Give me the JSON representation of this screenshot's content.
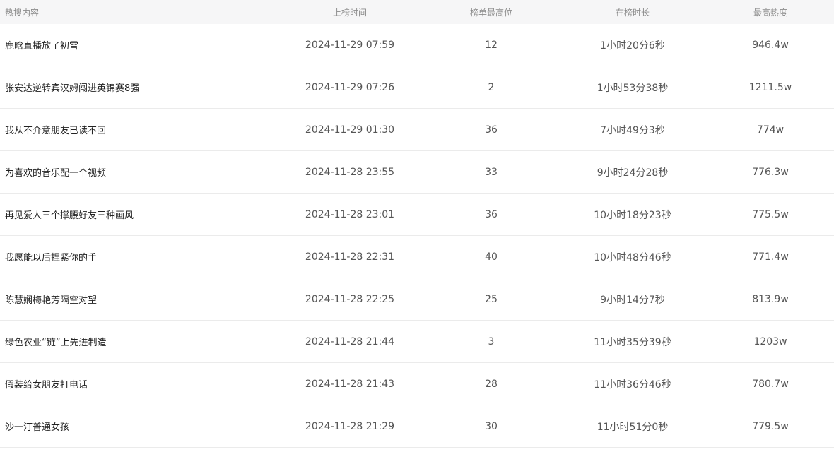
{
  "header": {
    "title": "热搜内容",
    "time": "上榜时间",
    "rank": "榜单最高位",
    "duration": "在榜时长",
    "heat": "最高热度"
  },
  "rows": [
    {
      "title": "鹿晗直播放了初雪",
      "time": "2024-11-29 07:59",
      "rank": "12",
      "duration": "1小时20分6秒",
      "heat": "946.4w"
    },
    {
      "title": "张安达逆转宾汉姆闯进英锦赛8强",
      "time": "2024-11-29 07:26",
      "rank": "2",
      "duration": "1小时53分38秒",
      "heat": "1211.5w"
    },
    {
      "title": "我从不介意朋友已读不回",
      "time": "2024-11-29 01:30",
      "rank": "36",
      "duration": "7小时49分3秒",
      "heat": "774w"
    },
    {
      "title": "为喜欢的音乐配一个视频",
      "time": "2024-11-28 23:55",
      "rank": "33",
      "duration": "9小时24分28秒",
      "heat": "776.3w"
    },
    {
      "title": "再见爱人三个撑腰好友三种画风",
      "time": "2024-11-28 23:01",
      "rank": "36",
      "duration": "10小时18分23秒",
      "heat": "775.5w"
    },
    {
      "title": "我愿能以后捏紧你的手",
      "time": "2024-11-28 22:31",
      "rank": "40",
      "duration": "10小时48分46秒",
      "heat": "771.4w"
    },
    {
      "title": "陈慧娴梅艳芳隔空对望",
      "time": "2024-11-28 22:25",
      "rank": "25",
      "duration": "9小时14分7秒",
      "heat": "813.9w"
    },
    {
      "title": "绿色农业“链”上先进制造",
      "time": "2024-11-28 21:44",
      "rank": "3",
      "duration": "11小时35分39秒",
      "heat": "1203w"
    },
    {
      "title": "假装给女朋友打电话",
      "time": "2024-11-28 21:43",
      "rank": "28",
      "duration": "11小时36分46秒",
      "heat": "780.7w"
    },
    {
      "title": "沙一汀普通女孩",
      "time": "2024-11-28 21:29",
      "rank": "30",
      "duration": "11小时51分0秒",
      "heat": "779.5w"
    }
  ]
}
